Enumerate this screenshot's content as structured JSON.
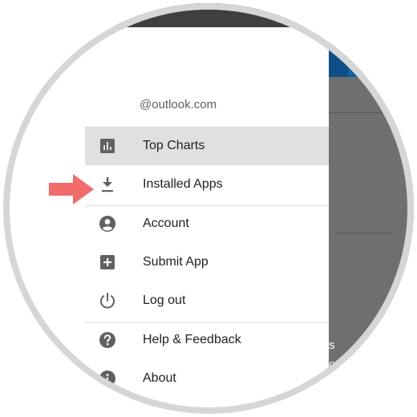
{
  "account": {
    "email": "@outlook.com"
  },
  "menu": {
    "items": [
      {
        "label": "Top Charts",
        "icon": "bar-chart-icon",
        "active": true
      },
      {
        "label": "Installed Apps",
        "icon": "download-icon",
        "active": false
      },
      {
        "label": "Account",
        "icon": "account-circle-icon",
        "active": false
      },
      {
        "label": "Submit App",
        "icon": "add-box-icon",
        "active": false
      },
      {
        "label": "Log out",
        "icon": "power-icon",
        "active": false
      },
      {
        "label": "Help & Feedback",
        "icon": "help-icon",
        "active": false
      },
      {
        "label": "About",
        "icon": "info-icon",
        "active": false
      }
    ]
  },
  "background": {
    "peek_text_1": "s",
    "peek_text_2": "om"
  },
  "colors": {
    "arrow": "#f26b6b",
    "active_row": "#e0e0e0",
    "icon": "#616161",
    "header_blue": "#0d4f86"
  }
}
